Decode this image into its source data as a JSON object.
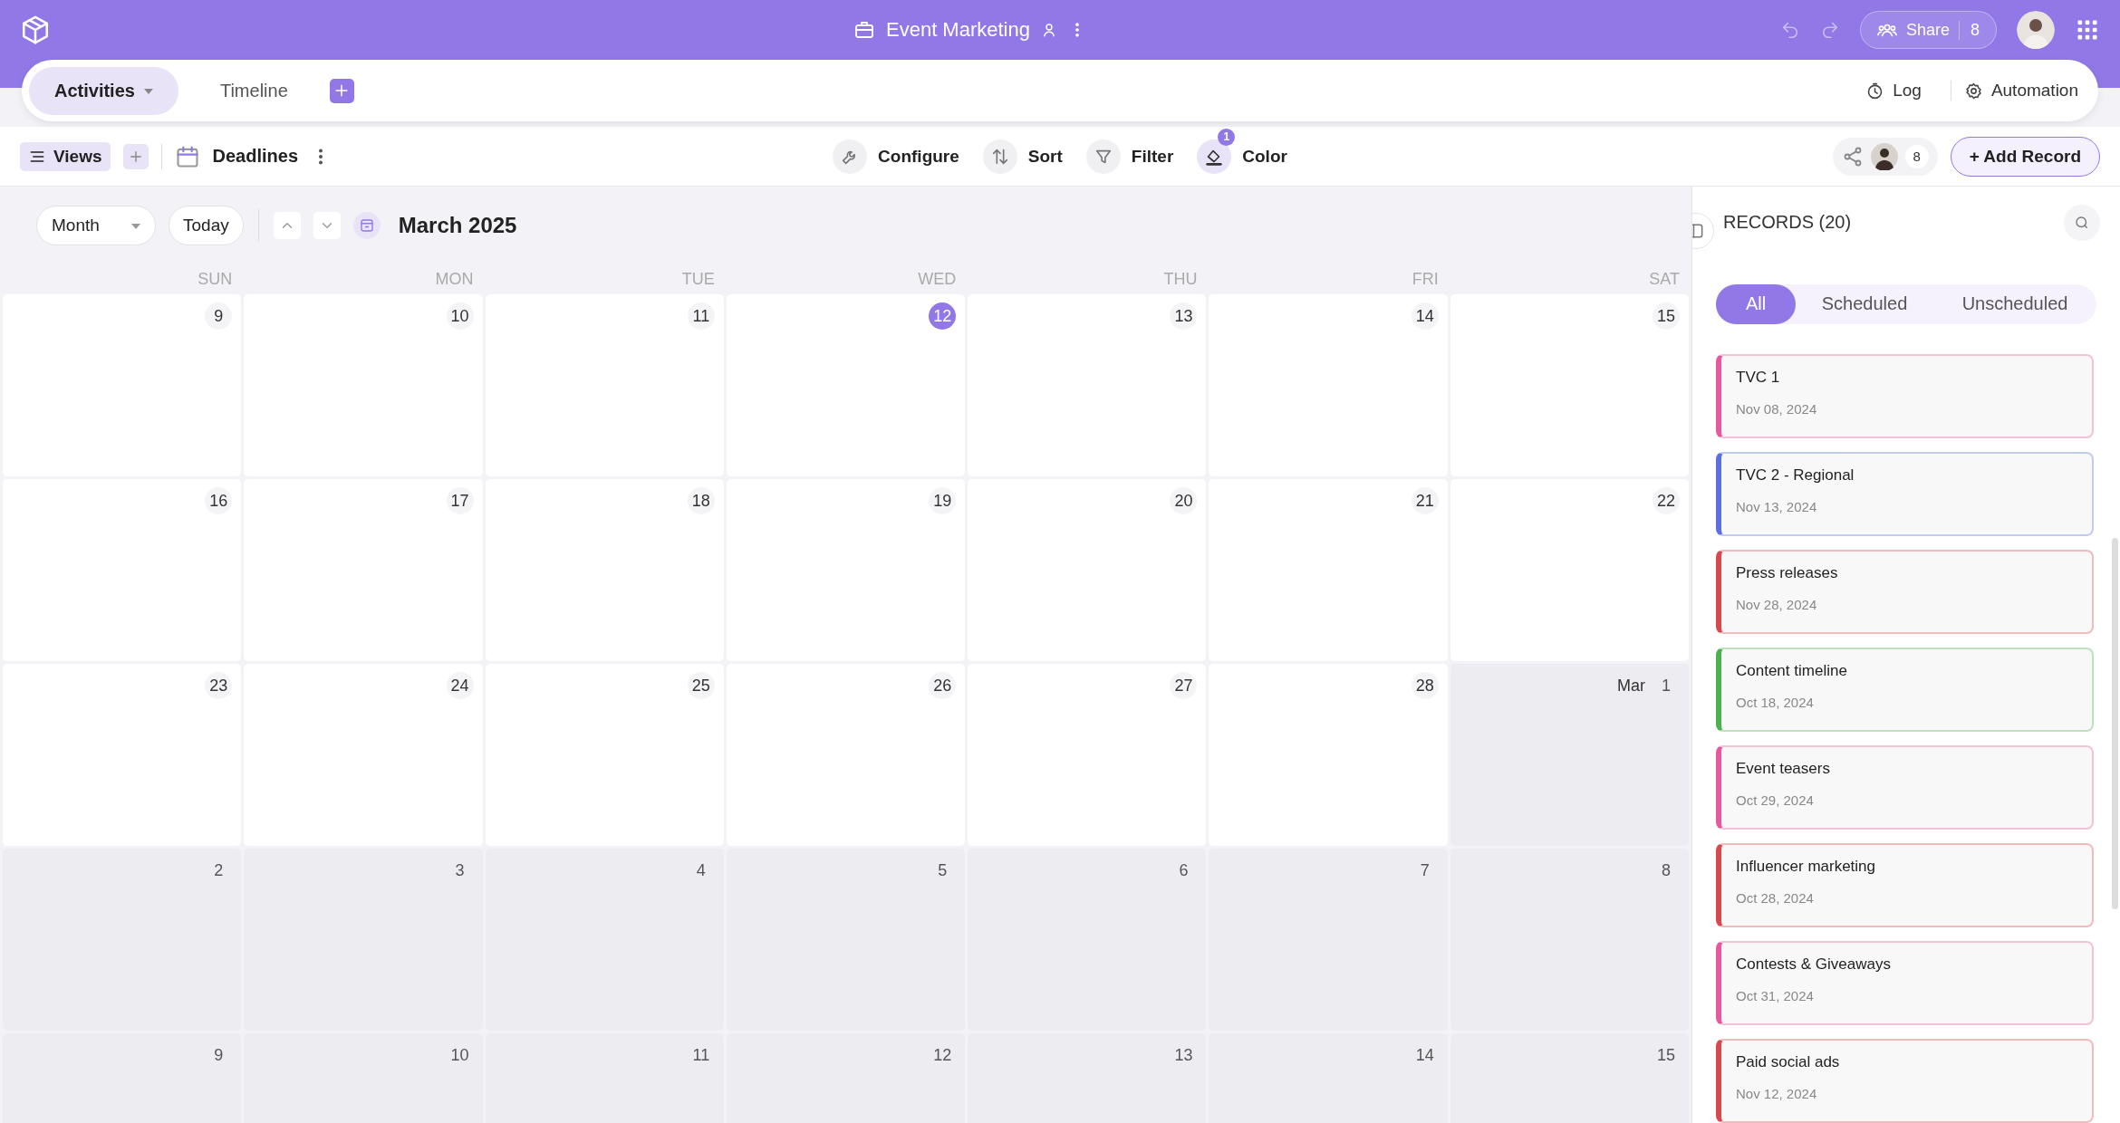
{
  "header": {
    "title": "Event Marketing",
    "share_label": "Share",
    "share_count": "8"
  },
  "tabs": [
    {
      "label": "Activities",
      "selected": true
    },
    {
      "label": "Timeline",
      "selected": false
    }
  ],
  "tab_actions": [
    {
      "kind": "log",
      "label": "Log"
    },
    {
      "kind": "automation",
      "label": "Automation"
    }
  ],
  "toolbar": {
    "views_label": "Views",
    "view_name": "Deadlines",
    "tools": [
      {
        "kind": "configure",
        "label": "Configure"
      },
      {
        "kind": "sort",
        "label": "Sort"
      },
      {
        "kind": "filter",
        "label": "Filter"
      },
      {
        "kind": "color",
        "label": "Color",
        "badge": "1"
      }
    ],
    "collaborator_count": "8",
    "add_label": "+ Add Record"
  },
  "calendar": {
    "mode": "Month",
    "today_label": "Today",
    "title": "March 2025",
    "weekdays": [
      "SUN",
      "MON",
      "TUE",
      "WED",
      "THU",
      "FRI",
      "SAT"
    ],
    "weeks": [
      [
        {
          "day": "9",
          "muted": false,
          "selected": false
        },
        {
          "day": "10",
          "muted": false,
          "selected": false
        },
        {
          "day": "11",
          "muted": false,
          "selected": false
        },
        {
          "day": "12",
          "muted": false,
          "selected": true
        },
        {
          "day": "13",
          "muted": false,
          "selected": false
        },
        {
          "day": "14",
          "muted": false,
          "selected": false
        },
        {
          "day": "15",
          "muted": false,
          "selected": false
        }
      ],
      [
        {
          "day": "16",
          "muted": false,
          "selected": false
        },
        {
          "day": "17",
          "muted": false,
          "selected": false
        },
        {
          "day": "18",
          "muted": false,
          "selected": false
        },
        {
          "day": "19",
          "muted": false,
          "selected": false
        },
        {
          "day": "20",
          "muted": false,
          "selected": false
        },
        {
          "day": "21",
          "muted": false,
          "selected": false
        },
        {
          "day": "22",
          "muted": false,
          "selected": false
        }
      ],
      [
        {
          "day": "23",
          "muted": false,
          "selected": false
        },
        {
          "day": "24",
          "muted": false,
          "selected": false
        },
        {
          "day": "25",
          "muted": false,
          "selected": false
        },
        {
          "day": "26",
          "muted": false,
          "selected": false
        },
        {
          "day": "27",
          "muted": false,
          "selected": false
        },
        {
          "day": "28",
          "muted": false,
          "selected": false
        },
        {
          "month": "Mar",
          "day": "1",
          "muted": true,
          "selected": false
        }
      ],
      [
        {
          "day": "2",
          "muted": true,
          "selected": false
        },
        {
          "day": "3",
          "muted": true,
          "selected": false
        },
        {
          "day": "4",
          "muted": true,
          "selected": false
        },
        {
          "day": "5",
          "muted": true,
          "selected": false
        },
        {
          "day": "6",
          "muted": true,
          "selected": false
        },
        {
          "day": "7",
          "muted": true,
          "selected": false
        },
        {
          "day": "8",
          "muted": true,
          "selected": false
        }
      ],
      [
        {
          "day": "9",
          "muted": true,
          "selected": false
        },
        {
          "day": "10",
          "muted": true,
          "selected": false
        },
        {
          "day": "11",
          "muted": true,
          "selected": false
        },
        {
          "day": "12",
          "muted": true,
          "selected": false
        },
        {
          "day": "13",
          "muted": true,
          "selected": false
        },
        {
          "day": "14",
          "muted": true,
          "selected": false
        },
        {
          "day": "15",
          "muted": true,
          "selected": false
        }
      ]
    ]
  },
  "records": {
    "title": "RECORDS (20)",
    "filters": [
      {
        "label": "All",
        "selected": true
      },
      {
        "label": "Scheduled",
        "selected": false
      },
      {
        "label": "Unscheduled",
        "selected": false
      }
    ],
    "items": [
      {
        "title": "TVC 1",
        "date": "Nov 08, 2024",
        "color": "#e8589c"
      },
      {
        "title": "TVC 2 - Regional",
        "date": "Nov 13, 2024",
        "color": "#5c6fe0"
      },
      {
        "title": "Press releases",
        "date": "Nov 28, 2024",
        "color": "#d9474f"
      },
      {
        "title": "Content timeline",
        "date": "Oct 18, 2024",
        "color": "#4cb050"
      },
      {
        "title": "Event teasers",
        "date": "Oct 29, 2024",
        "color": "#e8589c"
      },
      {
        "title": "Influencer marketing",
        "date": "Oct 28, 2024",
        "color": "#d9474f"
      },
      {
        "title": "Contests & Giveaways",
        "date": "Oct 31, 2024",
        "color": "#e8589c"
      },
      {
        "title": "Paid social ads",
        "date": "Nov 12, 2024",
        "color": "#d9474f"
      }
    ]
  }
}
